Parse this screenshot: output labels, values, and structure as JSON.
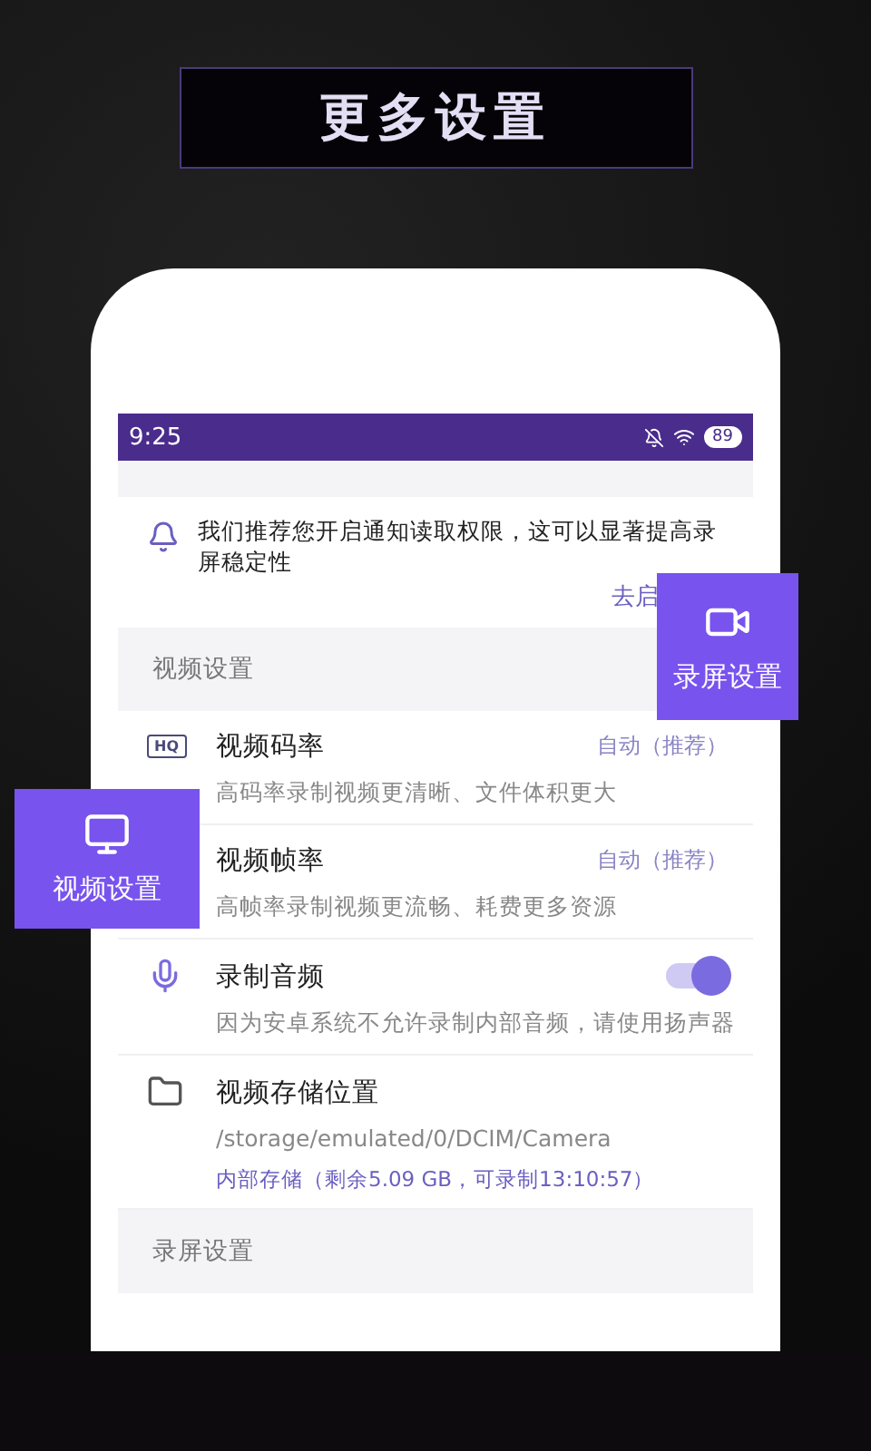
{
  "headline": "更多设置",
  "status_bar": {
    "time": "9:25",
    "battery": "89"
  },
  "notice": {
    "text": "我们推荐您开启通知读取权限，这可以显著提高录屏稳定性",
    "action": "去启"
  },
  "sections": [
    {
      "title": "视频设置",
      "rows": [
        {
          "kind": "value",
          "icon_text": "HQ",
          "title": "视频码率",
          "value": "自动（推荐）",
          "description": "高码率录制视频更清晰、文件体积更大"
        },
        {
          "kind": "value",
          "title": "视频帧率",
          "value": "自动（推荐）",
          "description": "高帧率录制视频更流畅、耗费更多资源"
        },
        {
          "kind": "toggle",
          "title": "录制音频",
          "on": true,
          "description": "因为安卓系统不允许录制内部音频，请使用扬声器"
        },
        {
          "kind": "storage",
          "title": "视频存储位置",
          "path": "/storage/emulated/0/DCIM/Camera",
          "info": "内部存储（剩余5.09 GB，可录制13:10:57）"
        }
      ]
    },
    {
      "title": "录屏设置"
    }
  ],
  "callouts": [
    {
      "kind": "screen-record",
      "label": "录屏设置"
    },
    {
      "kind": "video",
      "label": "视频设置"
    }
  ]
}
